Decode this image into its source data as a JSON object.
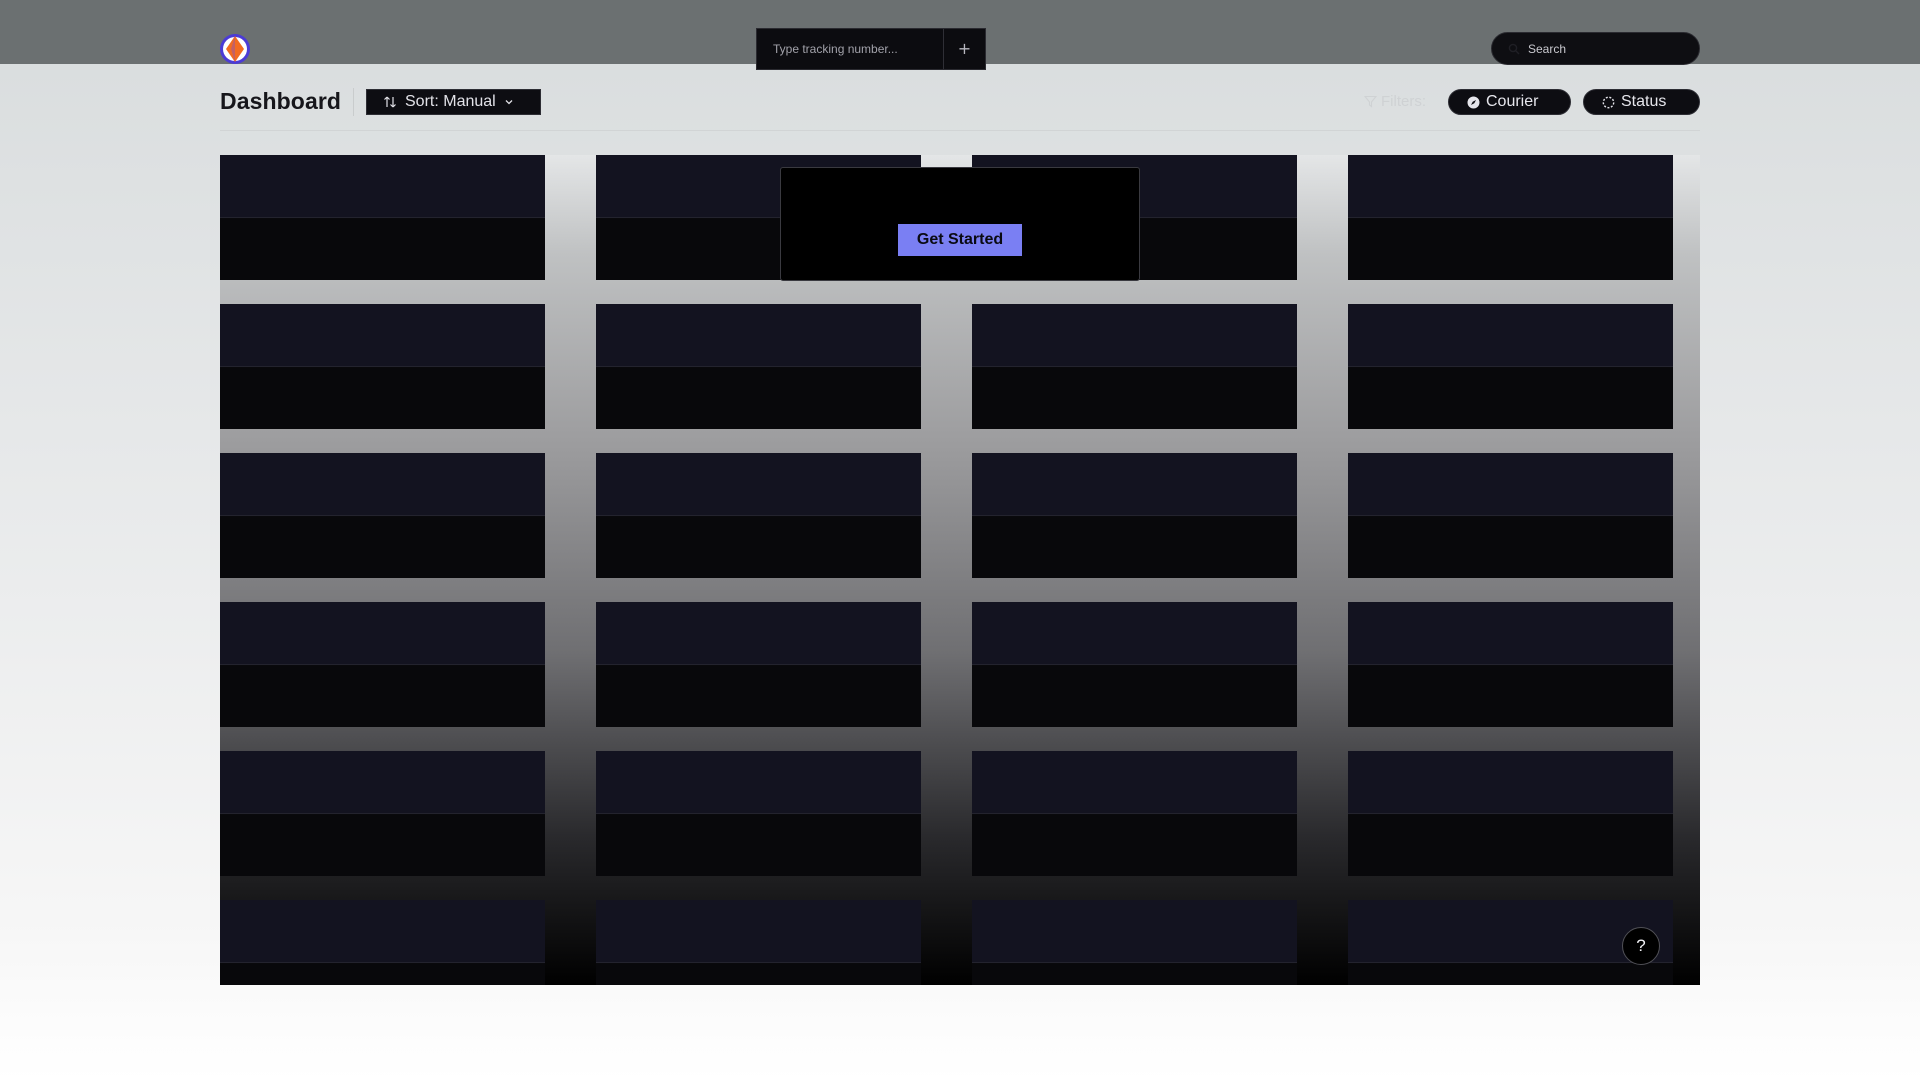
{
  "header": {
    "tracking_placeholder": "Type tracking number...",
    "add_label": "+",
    "search_placeholder": "Search"
  },
  "toolbar": {
    "title": "Dashboard",
    "sort_label": "Sort: Manual",
    "filters_label": "Filters:",
    "chips": [
      {
        "label": "Courier",
        "icon": "compass-icon"
      },
      {
        "label": "Status",
        "icon": "loading-icon"
      }
    ]
  },
  "grid": {
    "columns": 4,
    "rows": 6
  },
  "onboarding": {
    "button_label": "Get Started"
  },
  "help": {
    "label": "?"
  },
  "colors": {
    "topbar": "#6b7071",
    "accent": "#7a7ff3",
    "logo_orange": "#f26b21",
    "logo_purple": "#4c3bd6"
  }
}
